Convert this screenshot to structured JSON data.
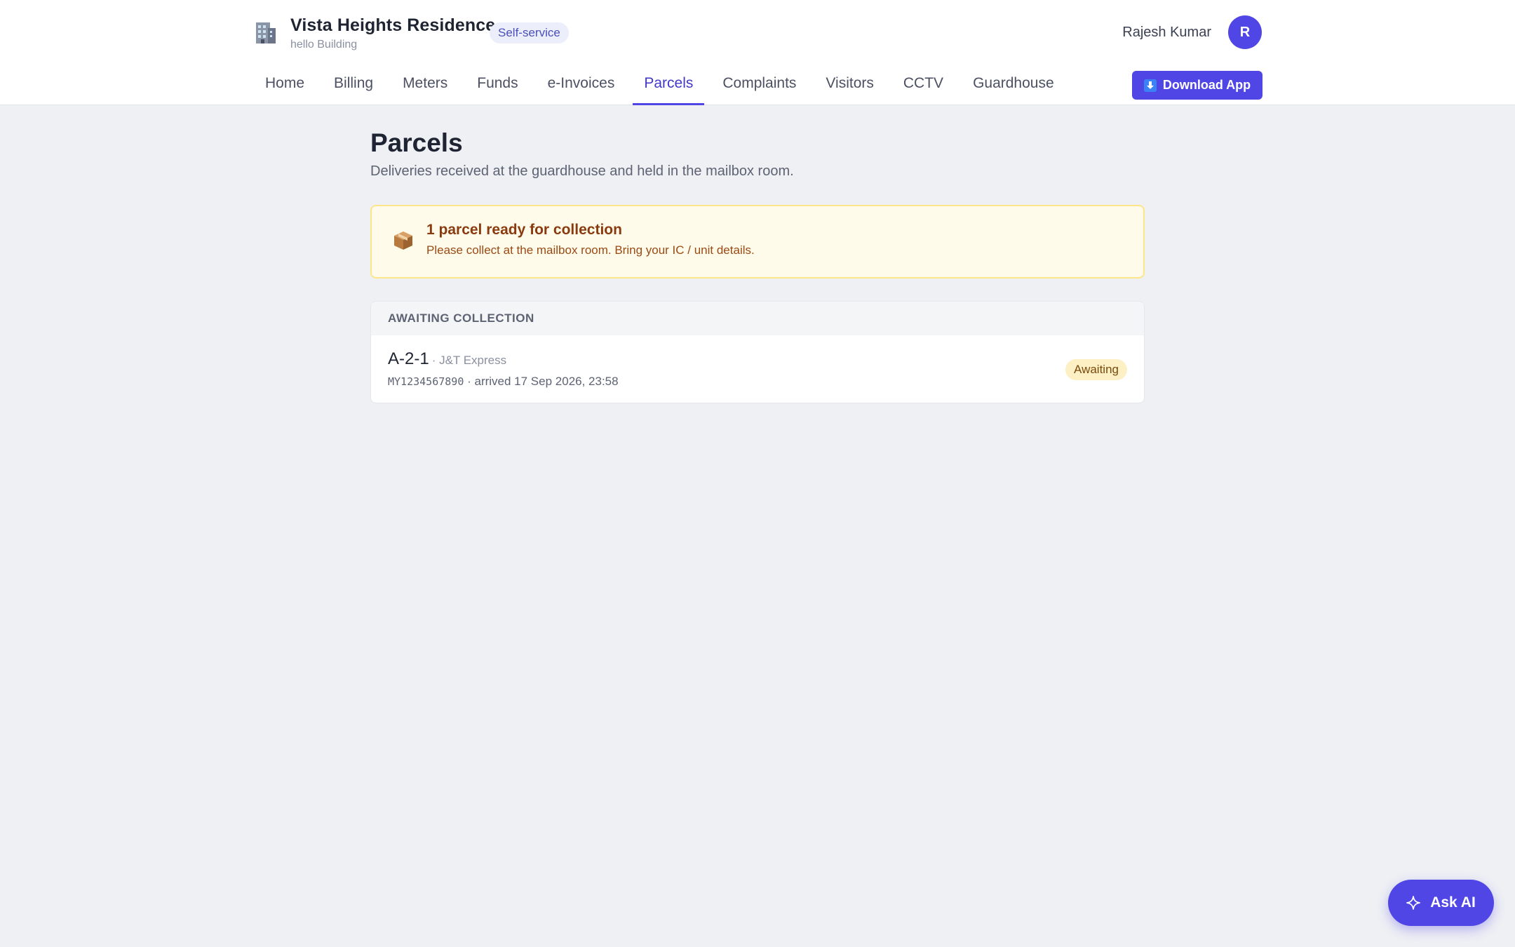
{
  "brand": {
    "title": "Vista Heights Residence",
    "subtitle": "hello Building",
    "badge": "Self-service",
    "icon": "building-icon"
  },
  "user": {
    "name": "Rajesh Kumar",
    "avatar_initial": "R"
  },
  "nav": {
    "items": [
      {
        "label": "Home"
      },
      {
        "label": "Billing"
      },
      {
        "label": "Meters"
      },
      {
        "label": "Funds"
      },
      {
        "label": "e-Invoices"
      },
      {
        "label": "Parcels",
        "active": true
      },
      {
        "label": "Complaints"
      },
      {
        "label": "Visitors"
      },
      {
        "label": "CCTV"
      },
      {
        "label": "Guardhouse"
      }
    ],
    "download_label": "Download App"
  },
  "page": {
    "title": "Parcels",
    "subtitle": "Deliveries received at the guardhouse and held in the mailbox room."
  },
  "alert": {
    "icon": "package-icon",
    "title": "1 parcel ready for collection",
    "text": "Please collect at the mailbox room. Bring your IC / unit details."
  },
  "awaiting": {
    "heading": "AWAITING COLLECTION",
    "rows": [
      {
        "unit": "A-2-1",
        "courier": "· J&T Express",
        "tracking": "MY1234567890",
        "arrived": "· arrived 17 Sep 2026, 23:58",
        "status": "Awaiting"
      }
    ]
  },
  "ask_ai": {
    "label": "Ask AI",
    "icon": "sparkle-icon"
  },
  "colors": {
    "accent": "#4f46e5",
    "background": "#eef0f4",
    "alert_bg": "#fefbea",
    "alert_border": "#fde68a",
    "status_bg": "#fdf0c4"
  }
}
